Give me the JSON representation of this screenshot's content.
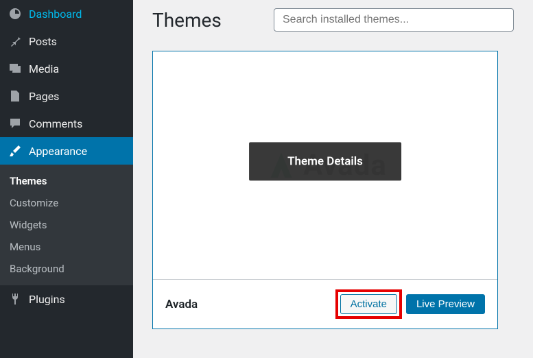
{
  "sidebar": {
    "items": [
      {
        "label": "Dashboard"
      },
      {
        "label": "Posts"
      },
      {
        "label": "Media"
      },
      {
        "label": "Pages"
      },
      {
        "label": "Comments"
      },
      {
        "label": "Appearance"
      },
      {
        "label": "Plugins"
      }
    ],
    "submenu": [
      {
        "label": "Themes"
      },
      {
        "label": "Customize"
      },
      {
        "label": "Widgets"
      },
      {
        "label": "Menus"
      },
      {
        "label": "Background"
      }
    ]
  },
  "header": {
    "title": "Themes",
    "search_placeholder": "Search installed themes..."
  },
  "theme": {
    "name": "Avada",
    "logo_text": "Avada",
    "overlay_label": "Theme Details",
    "activate_label": "Activate",
    "preview_label": "Live Preview"
  }
}
